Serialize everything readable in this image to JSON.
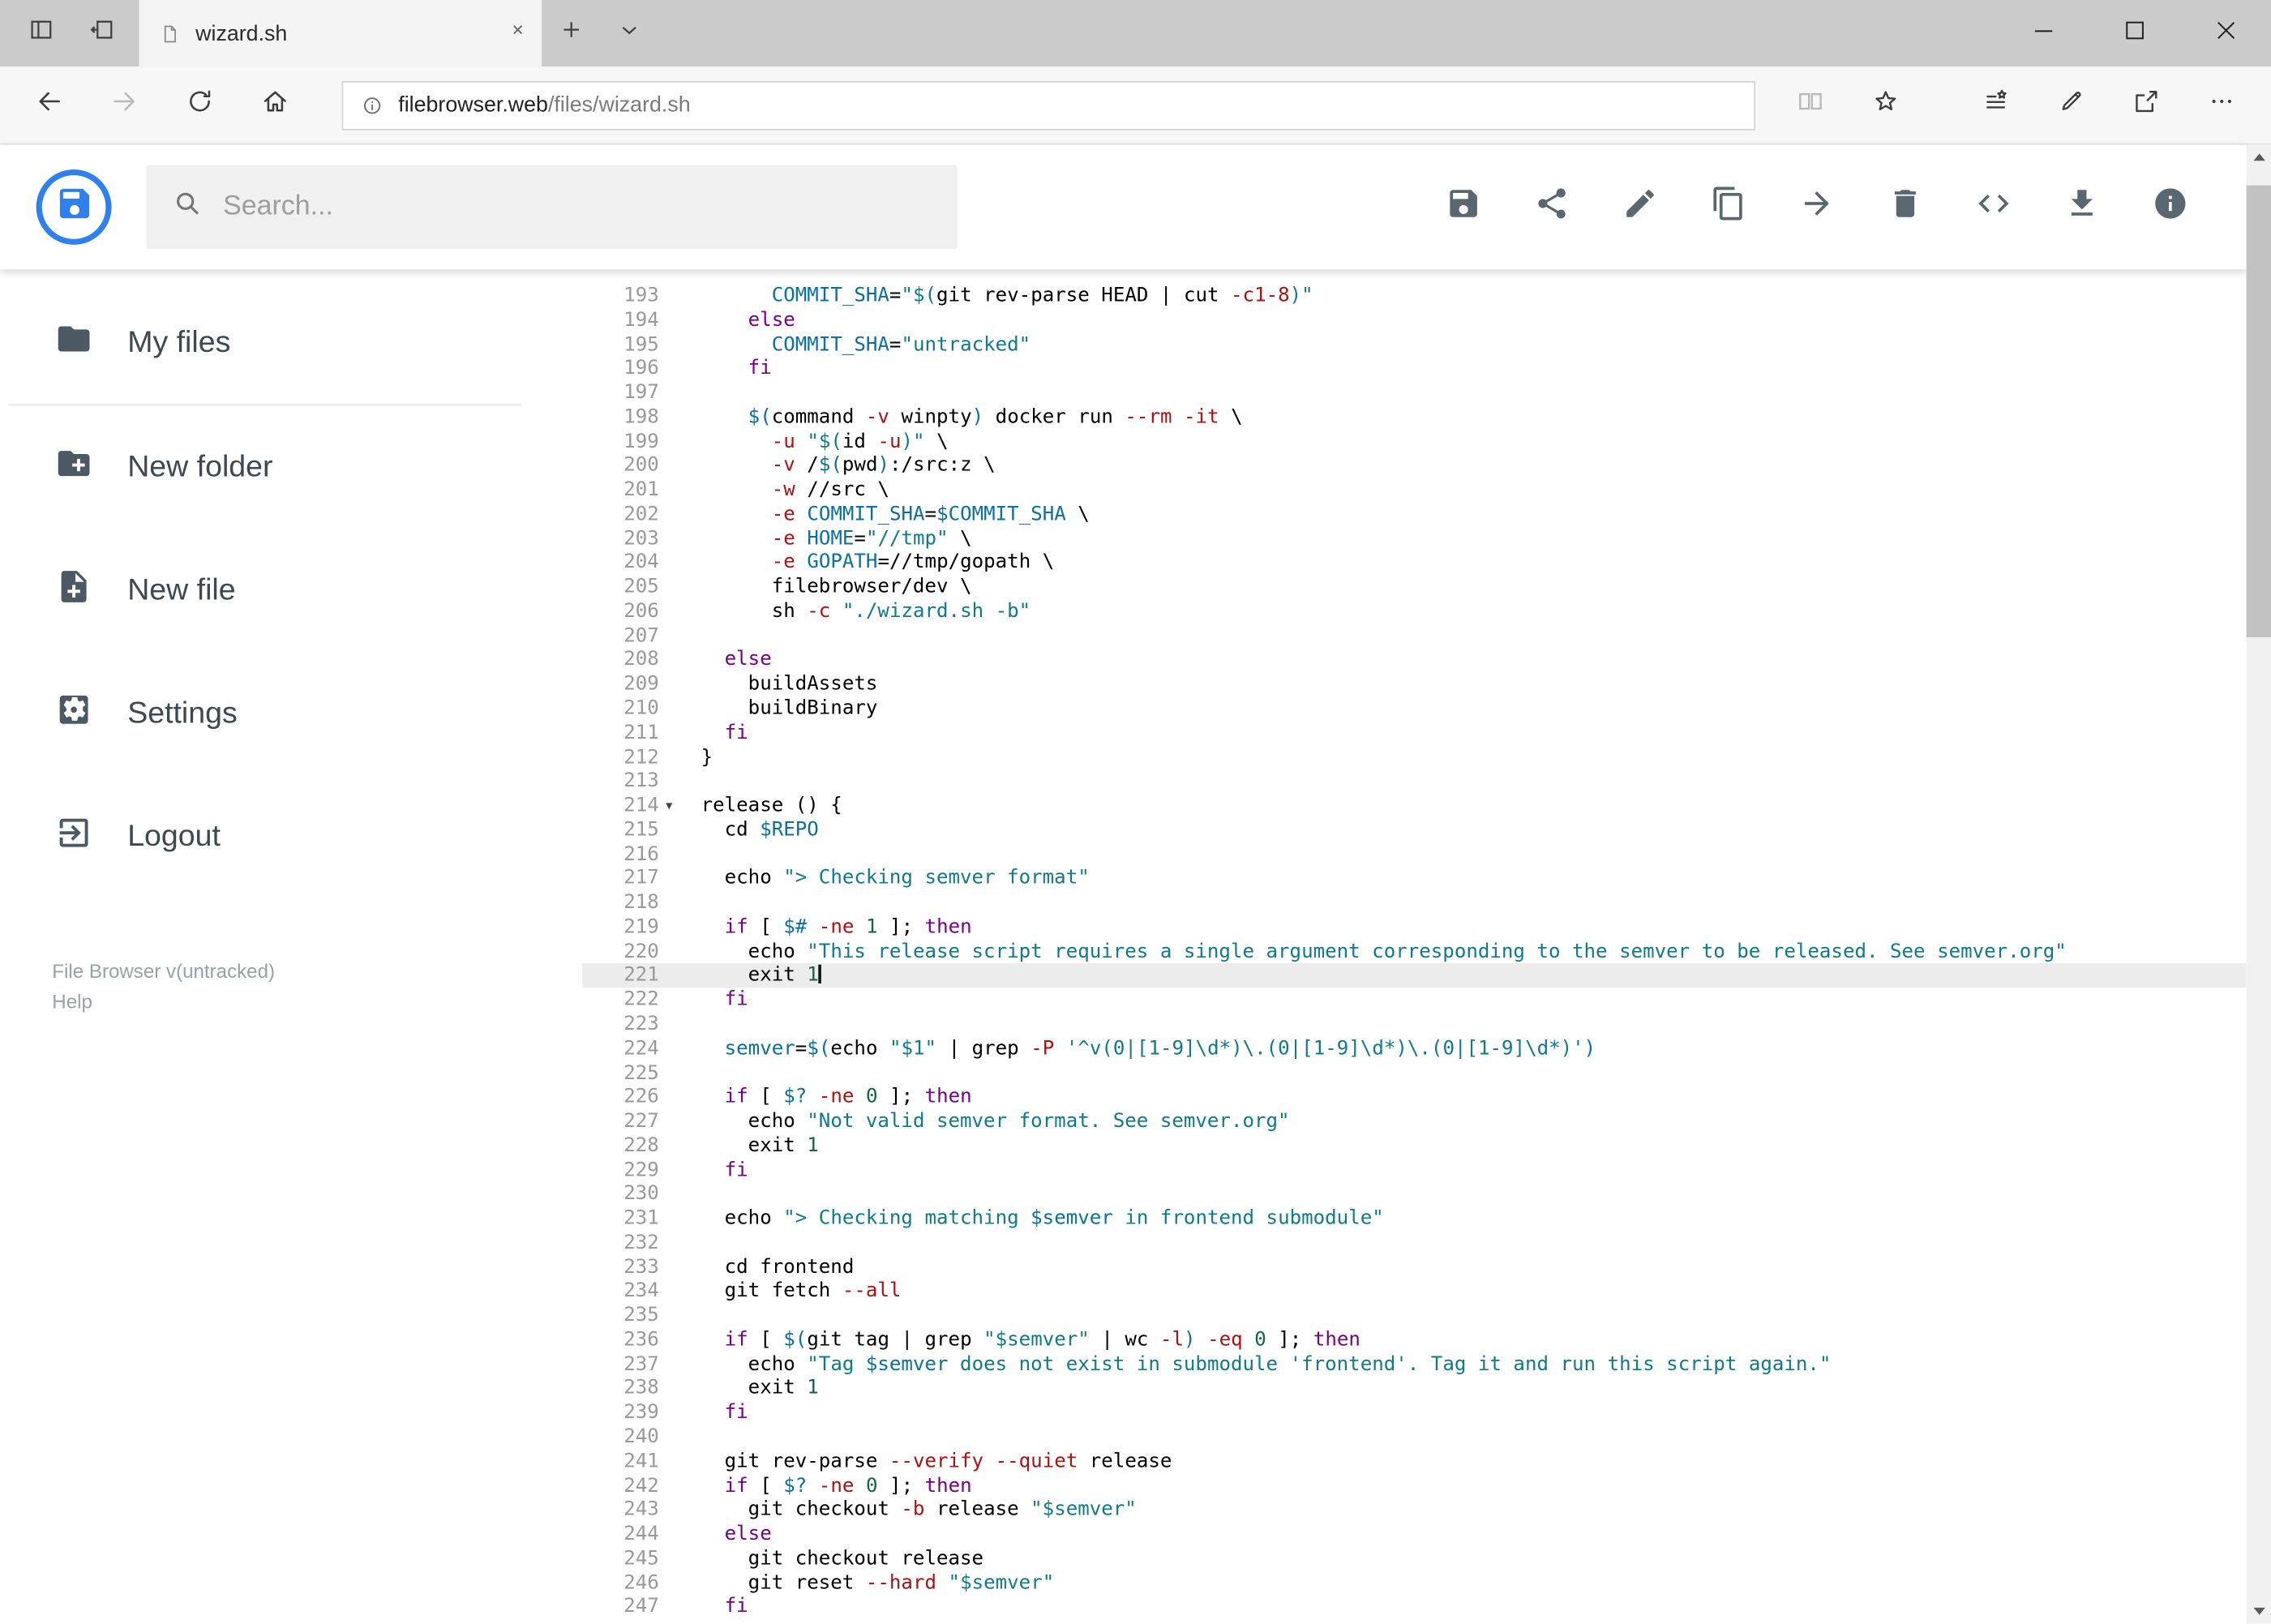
{
  "colors": {
    "accent": "#2f80ed",
    "syntax": {
      "k": "#770088",
      "s": "#0f7b8a",
      "v": "#0a6fa1",
      "n": "#116644",
      "a": "#aa1111",
      "gutter": "#999999"
    }
  },
  "titlebar": {
    "tab_title": "wizard.sh"
  },
  "navbar": {
    "url_host": "filebrowser.web",
    "url_path": "/files/wizard.sh"
  },
  "header": {
    "search_placeholder": "Search...",
    "toolbar_icons": [
      "save",
      "share",
      "edit",
      "copy",
      "move",
      "delete",
      "raw-code",
      "download",
      "info"
    ]
  },
  "sidebar": {
    "items": [
      {
        "label": "My files",
        "icon": "folder"
      },
      {
        "label": "New folder",
        "icon": "create-new-folder"
      },
      {
        "label": "New file",
        "icon": "new-file"
      },
      {
        "label": "Settings",
        "icon": "settings"
      },
      {
        "label": "Logout",
        "icon": "logout"
      }
    ],
    "footer": {
      "version": "File Browser v(untracked)",
      "help": "Help"
    }
  },
  "editor": {
    "active_line": 221,
    "lines": [
      {
        "n": 193,
        "t": [
          [
            "t",
            "      "
          ],
          [
            "v",
            "COMMIT_SHA"
          ],
          [
            "t",
            "="
          ],
          [
            "s",
            "\"$("
          ],
          [
            "t",
            "git rev-parse HEAD | cut "
          ],
          [
            "a",
            "-c1-8"
          ],
          [
            "s",
            ")\""
          ]
        ]
      },
      {
        "n": 194,
        "t": [
          [
            "t",
            "    "
          ],
          [
            "k",
            "else"
          ]
        ]
      },
      {
        "n": 195,
        "t": [
          [
            "t",
            "      "
          ],
          [
            "v",
            "COMMIT_SHA"
          ],
          [
            "t",
            "="
          ],
          [
            "s",
            "\"untracked\""
          ]
        ]
      },
      {
        "n": 196,
        "t": [
          [
            "t",
            "    "
          ],
          [
            "k",
            "fi"
          ]
        ]
      },
      {
        "n": 197,
        "t": []
      },
      {
        "n": 198,
        "t": [
          [
            "t",
            "    "
          ],
          [
            "v",
            "$("
          ],
          [
            "t",
            "command "
          ],
          [
            "a",
            "-v"
          ],
          [
            "t",
            " winpty"
          ],
          [
            "v",
            ")"
          ],
          [
            "t",
            " docker run "
          ],
          [
            "a",
            "--rm"
          ],
          [
            "t",
            " "
          ],
          [
            "a",
            "-it"
          ],
          [
            "t",
            " \\"
          ]
        ]
      },
      {
        "n": 199,
        "t": [
          [
            "t",
            "      "
          ],
          [
            "a",
            "-u"
          ],
          [
            "t",
            " "
          ],
          [
            "s",
            "\"$("
          ],
          [
            "t",
            "id "
          ],
          [
            "a",
            "-u"
          ],
          [
            "s",
            ")\""
          ],
          [
            "t",
            " \\"
          ]
        ]
      },
      {
        "n": 200,
        "t": [
          [
            "t",
            "      "
          ],
          [
            "a",
            "-v"
          ],
          [
            "t",
            " /"
          ],
          [
            "v",
            "$("
          ],
          [
            "t",
            "pwd"
          ],
          [
            "v",
            ")"
          ],
          [
            "t",
            ":/src:z \\"
          ]
        ]
      },
      {
        "n": 201,
        "t": [
          [
            "t",
            "      "
          ],
          [
            "a",
            "-w"
          ],
          [
            "t",
            " //src \\"
          ]
        ]
      },
      {
        "n": 202,
        "t": [
          [
            "t",
            "      "
          ],
          [
            "a",
            "-e"
          ],
          [
            "t",
            " "
          ],
          [
            "v",
            "COMMIT_SHA"
          ],
          [
            "t",
            "="
          ],
          [
            "v",
            "$COMMIT_SHA"
          ],
          [
            "t",
            " \\"
          ]
        ]
      },
      {
        "n": 203,
        "t": [
          [
            "t",
            "      "
          ],
          [
            "a",
            "-e"
          ],
          [
            "t",
            " "
          ],
          [
            "v",
            "HOME"
          ],
          [
            "t",
            "="
          ],
          [
            "s",
            "\"//tmp\""
          ],
          [
            "t",
            " \\"
          ]
        ]
      },
      {
        "n": 204,
        "t": [
          [
            "t",
            "      "
          ],
          [
            "a",
            "-e"
          ],
          [
            "t",
            " "
          ],
          [
            "v",
            "GOPATH"
          ],
          [
            "t",
            "=//tmp/gopath \\"
          ]
        ]
      },
      {
        "n": 205,
        "t": [
          [
            "t",
            "      filebrowser/dev \\"
          ]
        ]
      },
      {
        "n": 206,
        "t": [
          [
            "t",
            "      sh "
          ],
          [
            "a",
            "-c"
          ],
          [
            "t",
            " "
          ],
          [
            "s",
            "\"./wizard.sh -b\""
          ]
        ]
      },
      {
        "n": 207,
        "t": []
      },
      {
        "n": 208,
        "t": [
          [
            "t",
            "  "
          ],
          [
            "k",
            "else"
          ]
        ]
      },
      {
        "n": 209,
        "t": [
          [
            "t",
            "    buildAssets"
          ]
        ]
      },
      {
        "n": 210,
        "t": [
          [
            "t",
            "    buildBinary"
          ]
        ]
      },
      {
        "n": 211,
        "t": [
          [
            "t",
            "  "
          ],
          [
            "k",
            "fi"
          ]
        ]
      },
      {
        "n": 212,
        "t": [
          [
            "t",
            "}"
          ]
        ]
      },
      {
        "n": 213,
        "t": []
      },
      {
        "n": 214,
        "fold": true,
        "t": [
          [
            "t",
            "release () {"
          ]
        ]
      },
      {
        "n": 215,
        "t": [
          [
            "t",
            "  cd "
          ],
          [
            "v",
            "$REPO"
          ]
        ]
      },
      {
        "n": 216,
        "t": []
      },
      {
        "n": 217,
        "t": [
          [
            "t",
            "  echo "
          ],
          [
            "s",
            "\"> Checking semver format\""
          ]
        ]
      },
      {
        "n": 218,
        "t": []
      },
      {
        "n": 219,
        "t": [
          [
            "t",
            "  "
          ],
          [
            "k",
            "if"
          ],
          [
            "t",
            " [ "
          ],
          [
            "v",
            "$#"
          ],
          [
            "t",
            " "
          ],
          [
            "a",
            "-ne"
          ],
          [
            "t",
            " "
          ],
          [
            "n",
            "1"
          ],
          [
            "t",
            " ]; "
          ],
          [
            "k",
            "then"
          ]
        ]
      },
      {
        "n": 220,
        "t": [
          [
            "t",
            "    echo "
          ],
          [
            "s",
            "\"This release script requires a single argument corresponding to the semver to be released. See semver.org\""
          ]
        ]
      },
      {
        "n": 221,
        "active": true,
        "t": [
          [
            "t",
            "    exit "
          ],
          [
            "n",
            "1"
          ],
          [
            "cur",
            ""
          ]
        ]
      },
      {
        "n": 222,
        "t": [
          [
            "t",
            "  "
          ],
          [
            "k",
            "fi"
          ]
        ]
      },
      {
        "n": 223,
        "t": []
      },
      {
        "n": 224,
        "t": [
          [
            "t",
            "  "
          ],
          [
            "v",
            "semver"
          ],
          [
            "t",
            "="
          ],
          [
            "v",
            "$("
          ],
          [
            "t",
            "echo "
          ],
          [
            "s",
            "\"$1\""
          ],
          [
            "t",
            " | grep "
          ],
          [
            "a",
            "-P"
          ],
          [
            "t",
            " "
          ],
          [
            "s",
            "'^v(0|[1-9]\\d*)\\.(0|[1-9]\\d*)\\.(0|[1-9]\\d*)'"
          ],
          [
            "v",
            ")"
          ]
        ]
      },
      {
        "n": 225,
        "t": []
      },
      {
        "n": 226,
        "t": [
          [
            "t",
            "  "
          ],
          [
            "k",
            "if"
          ],
          [
            "t",
            " [ "
          ],
          [
            "v",
            "$?"
          ],
          [
            "t",
            " "
          ],
          [
            "a",
            "-ne"
          ],
          [
            "t",
            " "
          ],
          [
            "n",
            "0"
          ],
          [
            "t",
            " ]; "
          ],
          [
            "k",
            "then"
          ]
        ]
      },
      {
        "n": 227,
        "t": [
          [
            "t",
            "    echo "
          ],
          [
            "s",
            "\"Not valid semver format. See semver.org\""
          ]
        ]
      },
      {
        "n": 228,
        "t": [
          [
            "t",
            "    exit "
          ],
          [
            "n",
            "1"
          ]
        ]
      },
      {
        "n": 229,
        "t": [
          [
            "t",
            "  "
          ],
          [
            "k",
            "fi"
          ]
        ]
      },
      {
        "n": 230,
        "t": []
      },
      {
        "n": 231,
        "t": [
          [
            "t",
            "  echo "
          ],
          [
            "s",
            "\"> Checking matching "
          ],
          [
            "v",
            "$semver"
          ],
          [
            "s",
            " in frontend submodule\""
          ]
        ]
      },
      {
        "n": 232,
        "t": []
      },
      {
        "n": 233,
        "t": [
          [
            "t",
            "  cd frontend"
          ]
        ]
      },
      {
        "n": 234,
        "t": [
          [
            "t",
            "  git fetch "
          ],
          [
            "a",
            "--all"
          ]
        ]
      },
      {
        "n": 235,
        "t": []
      },
      {
        "n": 236,
        "t": [
          [
            "t",
            "  "
          ],
          [
            "k",
            "if"
          ],
          [
            "t",
            " [ "
          ],
          [
            "v",
            "$("
          ],
          [
            "t",
            "git tag | grep "
          ],
          [
            "s",
            "\"$semver\""
          ],
          [
            "t",
            " | wc "
          ],
          [
            "a",
            "-l"
          ],
          [
            "v",
            ")"
          ],
          [
            "t",
            " "
          ],
          [
            "a",
            "-eq"
          ],
          [
            "t",
            " "
          ],
          [
            "n",
            "0"
          ],
          [
            "t",
            " ]; "
          ],
          [
            "k",
            "then"
          ]
        ]
      },
      {
        "n": 237,
        "t": [
          [
            "t",
            "    echo "
          ],
          [
            "s",
            "\"Tag "
          ],
          [
            "v",
            "$semver"
          ],
          [
            "s",
            " does not exist in submodule 'frontend'. Tag it and run this script again.\""
          ]
        ]
      },
      {
        "n": 238,
        "t": [
          [
            "t",
            "    exit "
          ],
          [
            "n",
            "1"
          ]
        ]
      },
      {
        "n": 239,
        "t": [
          [
            "t",
            "  "
          ],
          [
            "k",
            "fi"
          ]
        ]
      },
      {
        "n": 240,
        "t": []
      },
      {
        "n": 241,
        "t": [
          [
            "t",
            "  git rev-parse "
          ],
          [
            "a",
            "--verify"
          ],
          [
            "t",
            " "
          ],
          [
            "a",
            "--quiet"
          ],
          [
            "t",
            " release"
          ]
        ]
      },
      {
        "n": 242,
        "t": [
          [
            "t",
            "  "
          ],
          [
            "k",
            "if"
          ],
          [
            "t",
            " [ "
          ],
          [
            "v",
            "$?"
          ],
          [
            "t",
            " "
          ],
          [
            "a",
            "-ne"
          ],
          [
            "t",
            " "
          ],
          [
            "n",
            "0"
          ],
          [
            "t",
            " ]; "
          ],
          [
            "k",
            "then"
          ]
        ]
      },
      {
        "n": 243,
        "t": [
          [
            "t",
            "    git checkout "
          ],
          [
            "a",
            "-b"
          ],
          [
            "t",
            " release "
          ],
          [
            "s",
            "\"$semver\""
          ]
        ]
      },
      {
        "n": 244,
        "t": [
          [
            "t",
            "  "
          ],
          [
            "k",
            "else"
          ]
        ]
      },
      {
        "n": 245,
        "t": [
          [
            "t",
            "    git checkout release"
          ]
        ]
      },
      {
        "n": 246,
        "t": [
          [
            "t",
            "    git reset "
          ],
          [
            "a",
            "--hard"
          ],
          [
            "t",
            " "
          ],
          [
            "s",
            "\"$semver\""
          ]
        ]
      },
      {
        "n": 247,
        "t": [
          [
            "t",
            "  "
          ],
          [
            "k",
            "fi"
          ]
        ]
      }
    ]
  }
}
